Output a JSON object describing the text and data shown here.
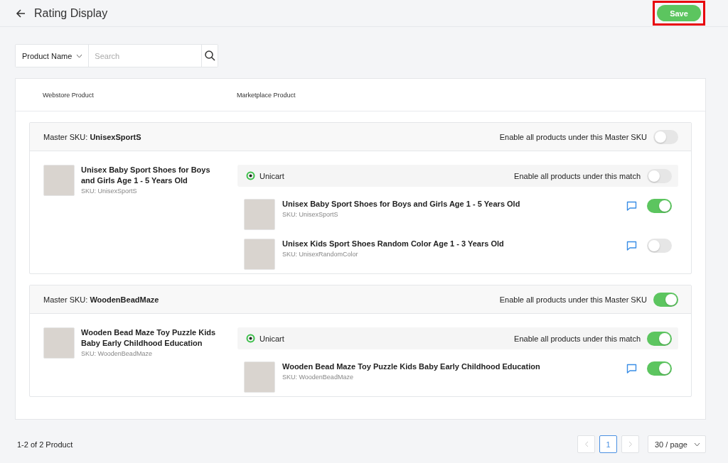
{
  "header": {
    "title": "Rating Display",
    "save_label": "Save",
    "save_highlighted": true
  },
  "filter": {
    "field": "Product Name",
    "placeholder": "Search"
  },
  "columns": [
    "Webstore Product",
    "Marketplace Product"
  ],
  "groups": [
    {
      "master": "Master SKU: **UnisexSportS**",
      "enable_label": "Enable all products under this Master SKU",
      "enabled": false,
      "product": {
        "name": "Unisex Baby Sport Shoes for Boys and Girls Age 1 - 5 Years Old",
        "sku": "SKU: UnisexSportS"
      },
      "match": {
        "channel": "Unicart",
        "enable_label": "Enable all products under this match",
        "enabled": false,
        "items": [
          {
            "name": "Unisex Baby Sport Shoes for Boys and Girls Age 1 - 5 Years Old",
            "sku": "SKU: UnisexSportS",
            "enabled": true
          },
          {
            "name": "Unisex Kids Sport Shoes Random Color Age 1 - 3 Years Old",
            "sku": "SKU: UnisexRandomColor",
            "enabled": false
          }
        ]
      }
    },
    {
      "master": "Master SKU: **WoodenBeadMaze**",
      "enable_label": "Enable all products under this Master SKU",
      "enabled": true,
      "product": {
        "name": "Wooden Bead Maze Toy Puzzle Kids Baby Early Childhood Education",
        "sku": "SKU: WoodenBeadMaze"
      },
      "match": {
        "channel": "Unicart",
        "enable_label": "Enable all products under this match",
        "enabled": true,
        "items": [
          {
            "name": "Wooden Bead Maze Toy Puzzle Kids Baby Early Childhood Education",
            "sku": "SKU: WoodenBeadMaze",
            "enabled": true
          }
        ]
      }
    }
  ],
  "footer": {
    "summary": "1-2 of 2 Product",
    "pages": [
      {
        "label": "1",
        "selected": true
      }
    ],
    "page_size": "30 / page"
  }
}
